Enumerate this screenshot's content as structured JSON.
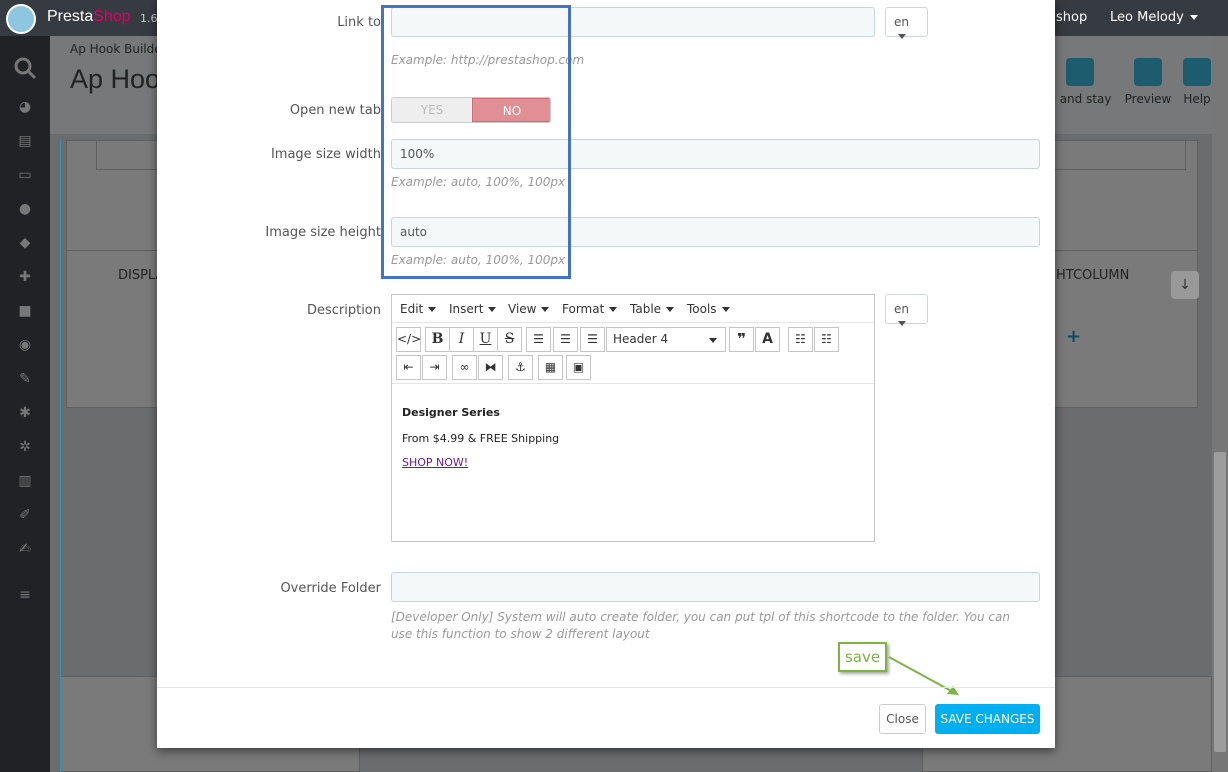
{
  "topbar": {
    "logo_text_a": "Presta",
    "logo_text_b": "Shop",
    "version": "1.6.",
    "shop_link": "shop",
    "user_name": "Leo Melody"
  },
  "page": {
    "breadcrumb": "Ap Hook Builde",
    "title": "Ap Hoo",
    "toolbar": {
      "save_stay": "e and stay",
      "preview": "Preview",
      "help": "Help"
    },
    "bg_left_label": "DISPLA",
    "bg_right_label": "HTCOLUMN"
  },
  "modal": {
    "link_to": {
      "label": "Link to",
      "value": "",
      "hint": "Example: http://prestashop.com",
      "lang": "en"
    },
    "open_new_tab": {
      "label": "Open new tab",
      "yes": "YES",
      "no": "NO",
      "selected": "NO"
    },
    "image_width": {
      "label": "Image size width",
      "value": "100%",
      "hint": "Example: auto, 100%, 100px"
    },
    "image_height": {
      "label": "Image size height",
      "value": "auto",
      "hint": "Example: auto, 100%, 100px"
    },
    "description": {
      "label": "Description",
      "lang": "en",
      "menu": [
        "Edit",
        "Insert",
        "View",
        "Format",
        "Table",
        "Tools"
      ],
      "format_select": "Header 4",
      "content": {
        "heading": "Designer Series",
        "line": "From $4.99 & FREE Shipping",
        "link": "SHOP NOW!"
      }
    },
    "override_folder": {
      "label": "Override Folder",
      "value": "",
      "hint": "[Developer Only] System will auto create folder, you can put tpl of this shortcode to the folder. You can use this function to show 2 different layout"
    },
    "footer": {
      "close": "Close",
      "save": "SAVE CHANGES"
    }
  },
  "annotation": {
    "callout": "save",
    "highlight_color": "#4472c4",
    "arrow_color": "#7cb342"
  },
  "colors": {
    "save_button": "#00aff0",
    "no_toggle": "#e08f95"
  }
}
